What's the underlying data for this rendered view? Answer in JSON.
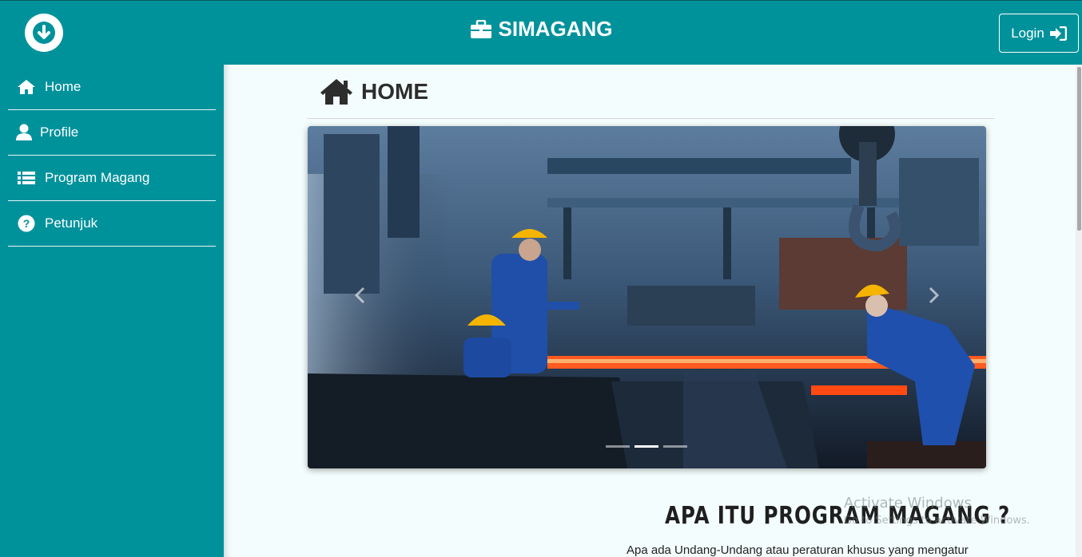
{
  "header": {
    "brand": "SIMAGANG",
    "login_label": "Login",
    "icons": {
      "toggle": "arrow-down-circle-icon",
      "brand": "briefcase-icon",
      "login": "sign-in-icon"
    }
  },
  "sidebar": {
    "items": [
      {
        "label": "Home",
        "icon": "home-icon"
      },
      {
        "label": "Profile",
        "icon": "user-icon"
      },
      {
        "label": "Program Magang",
        "icon": "list-icon"
      },
      {
        "label": "Petunjuk",
        "icon": "question-circle-icon"
      }
    ]
  },
  "main": {
    "page_title": "HOME",
    "carousel": {
      "slide_count": 3,
      "active_slide": 2
    },
    "section_title": "APA ITU PROGRAM MAGANG ?",
    "section_text": "Apa ada Undang-Undang atau peraturan khusus yang mengatur"
  },
  "watermark": {
    "line1": "Activate Windows",
    "line2": "Go to Settings to activate Windows."
  },
  "colors": {
    "primary": "#00929b",
    "background": "#f4fdfd",
    "text": "#2d2d2d"
  }
}
